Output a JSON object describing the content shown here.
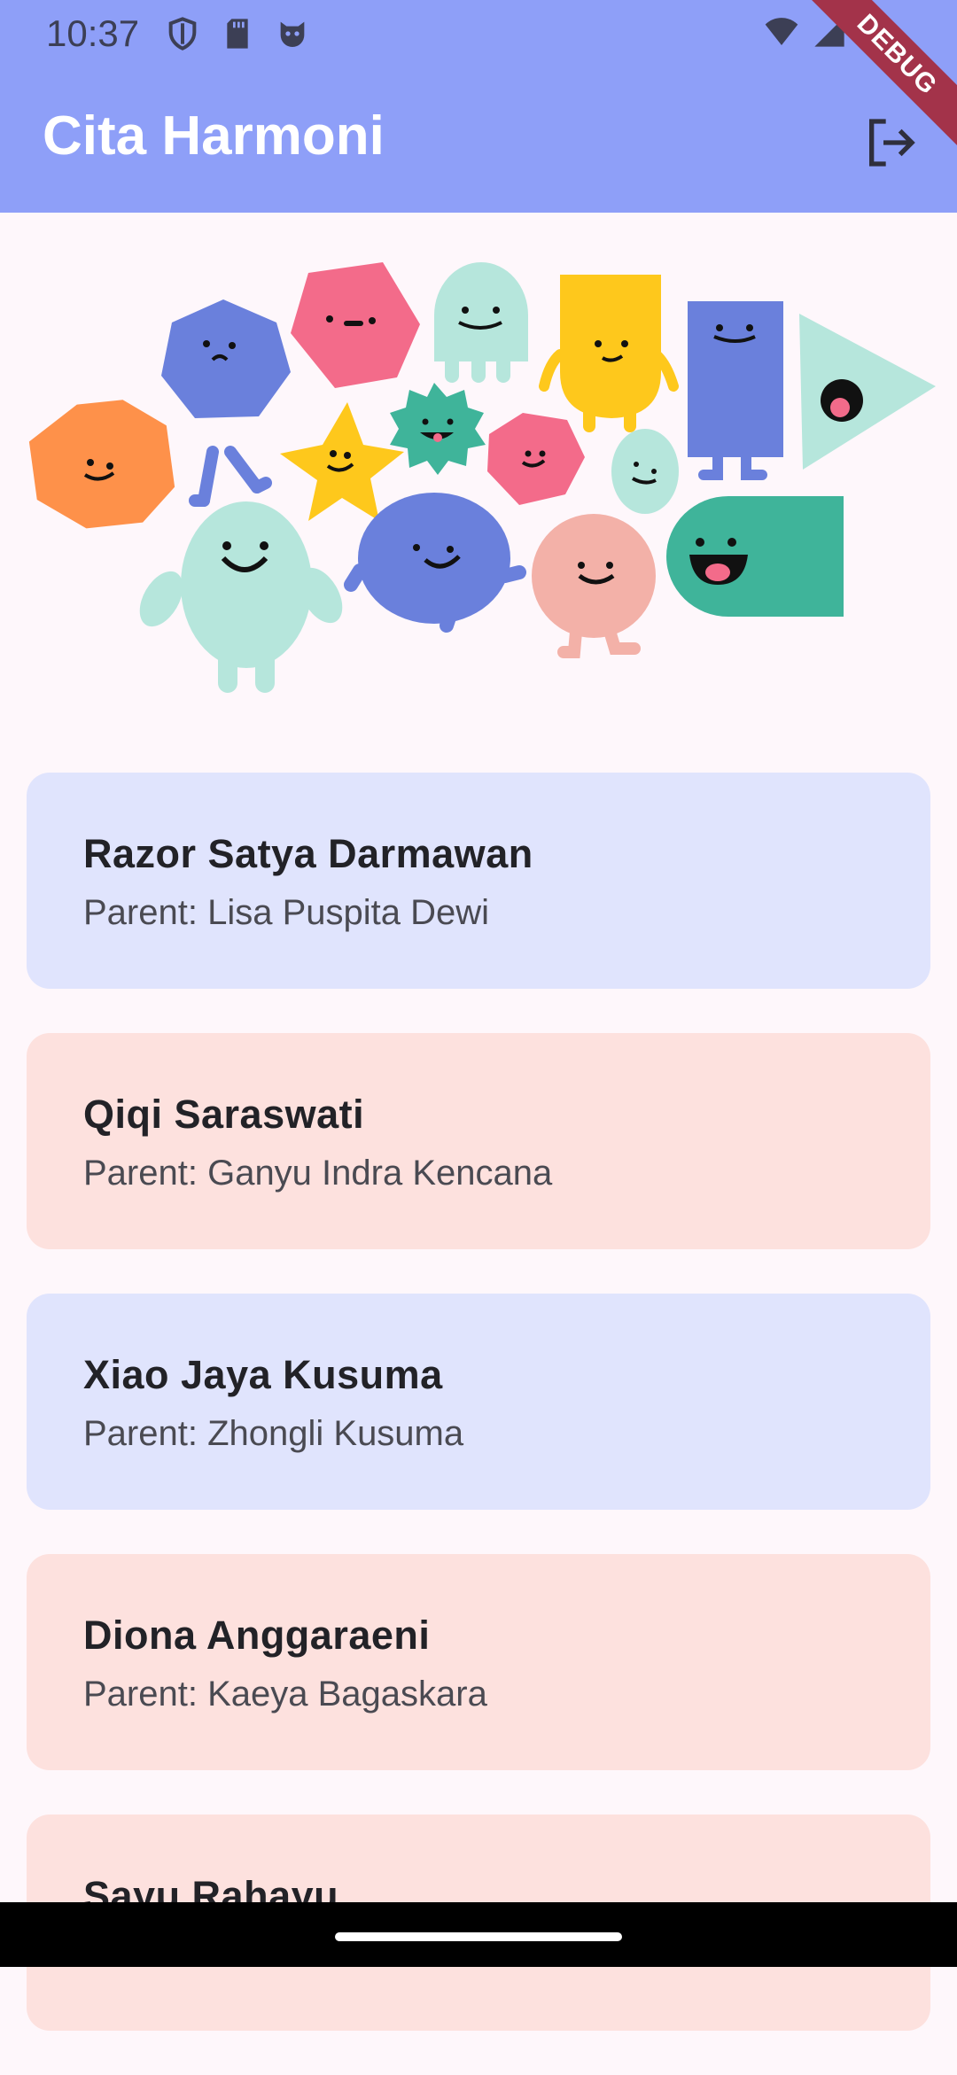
{
  "status_bar": {
    "time": "10:37",
    "left_icons": [
      "shield-icon",
      "sd-card-icon",
      "cat-face-icon"
    ],
    "right_icons": [
      "wifi-icon",
      "cell-signal-icon",
      "battery-icon"
    ]
  },
  "app_bar": {
    "title": "Cita Harmoni",
    "action_icon": "logout-icon",
    "background": "#8e9ff8"
  },
  "debug_banner": "DEBUG",
  "students": [
    {
      "name": "Razor Satya Darmawan",
      "parent": "Parent: Lisa Puspita Dewi",
      "color": "#e0e4fd"
    },
    {
      "name": "Qiqi Saraswati",
      "parent": "Parent: Ganyu Indra Kencana",
      "color": "#fde1de"
    },
    {
      "name": "Xiao Jaya Kusuma",
      "parent": "Parent: Zhongli Kusuma",
      "color": "#e0e4fd"
    },
    {
      "name": "Diona Anggaraeni",
      "parent": "Parent: Kaeya Bagaskara",
      "color": "#fde1de"
    },
    {
      "name": "Sayu Rahayu",
      "parent": "",
      "color": "#fde1de"
    }
  ]
}
